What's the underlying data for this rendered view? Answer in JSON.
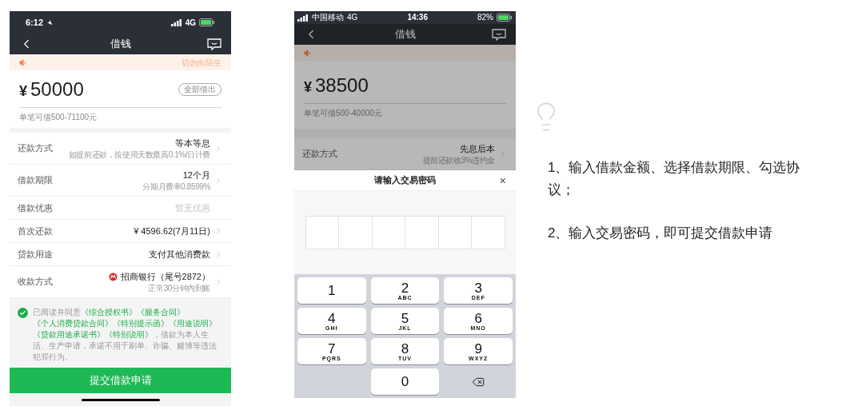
{
  "phones": [
    {
      "kind": "form",
      "status_bar": {
        "time": "6:12",
        "network": "4G"
      },
      "nav": {
        "title": "借钱"
      },
      "notice": {
        "text": "切勿向陌生"
      },
      "amount": {
        "currency": "¥",
        "value": "50000",
        "action": "全部借出",
        "hint": "单笔可借500-71100元"
      },
      "rows": [
        {
          "kind": "plain",
          "label": "还款方式",
          "value": "等本等息",
          "note": "如提前还款，按使用天数最高0.1%/日计费",
          "muted": false,
          "chevron": true
        },
        {
          "kind": "plain",
          "label": "借款期限",
          "value": "12个月",
          "note": "分期月费率0.8599%",
          "muted": false,
          "chevron": true
        },
        {
          "kind": "plain",
          "label": "借款优惠",
          "value": "暂无优惠",
          "muted": true,
          "chevron": false
        },
        {
          "kind": "plain",
          "label": "首次还款",
          "value": "¥ 4596.62(7月11日)",
          "muted": false,
          "chevron": true
        },
        {
          "kind": "plain",
          "label": "贷款用途",
          "value": "支付其他消费款",
          "muted": false,
          "chevron": true
        },
        {
          "kind": "bank",
          "label": "收款方式",
          "value": "招商银行（尾号2872）",
          "note": "正常30分钟内到账",
          "muted": false,
          "chevron": true
        }
      ],
      "agreement": {
        "checked": true,
        "prefix": "已阅读并同意",
        "links": [
          "《综合授权书》",
          "《服务合同》",
          "《个人消费贷款合同》",
          "《特别提示函》",
          "《用途说明》",
          "《贷款用途承诺书》",
          "《特别说明》"
        ],
        "suffix": "，借款为本人生活、生产申请，承诺不用于刷单、诈骗、赌博等违法犯罪行为。"
      },
      "submit": "提交借款申请"
    },
    {
      "kind": "password",
      "dimmed": true,
      "status_bar": {
        "carrier": "中国移动",
        "network": "4G",
        "time": "14:36",
        "battery": "82%"
      },
      "nav": {
        "title": "借钱"
      },
      "amount": {
        "currency": "¥",
        "value": "38500",
        "hint": "单笔可借500-40000元"
      },
      "rows": [
        {
          "kind": "plain",
          "label": "还款方式",
          "value": "先息后本",
          "note": "提前还款收3%违约金",
          "muted": false,
          "chevron": true
        }
      ],
      "dialog": {
        "title": "请输入交易密码",
        "close": "×",
        "cells": [
          {
            "filled": false
          },
          {
            "filled": false
          },
          {
            "filled": false
          },
          {
            "filled": false
          },
          {
            "filled": false
          },
          {
            "filled": false
          }
        ]
      },
      "keypad": [
        {
          "kind": "digit",
          "digit": "1"
        },
        {
          "kind": "digit",
          "digit": "2",
          "letters": "ABC"
        },
        {
          "kind": "digit",
          "digit": "3",
          "letters": "DEF"
        },
        {
          "kind": "digit",
          "digit": "4",
          "letters": "GHI"
        },
        {
          "kind": "digit",
          "digit": "5",
          "letters": "JKL"
        },
        {
          "kind": "digit",
          "digit": "6",
          "letters": "MNO"
        },
        {
          "kind": "digit",
          "digit": "7",
          "letters": "PQRS"
        },
        {
          "kind": "digit",
          "digit": "8",
          "letters": "TUV"
        },
        {
          "kind": "digit",
          "digit": "9",
          "letters": "WXYZ"
        },
        {
          "kind": "blank"
        },
        {
          "kind": "digit",
          "digit": "0"
        },
        {
          "kind": "delete"
        }
      ]
    }
  ],
  "steps": [
    "1、输入借款金额、选择借款期限、勾选协议；",
    "2、输入交易密码，即可提交借款申请"
  ]
}
